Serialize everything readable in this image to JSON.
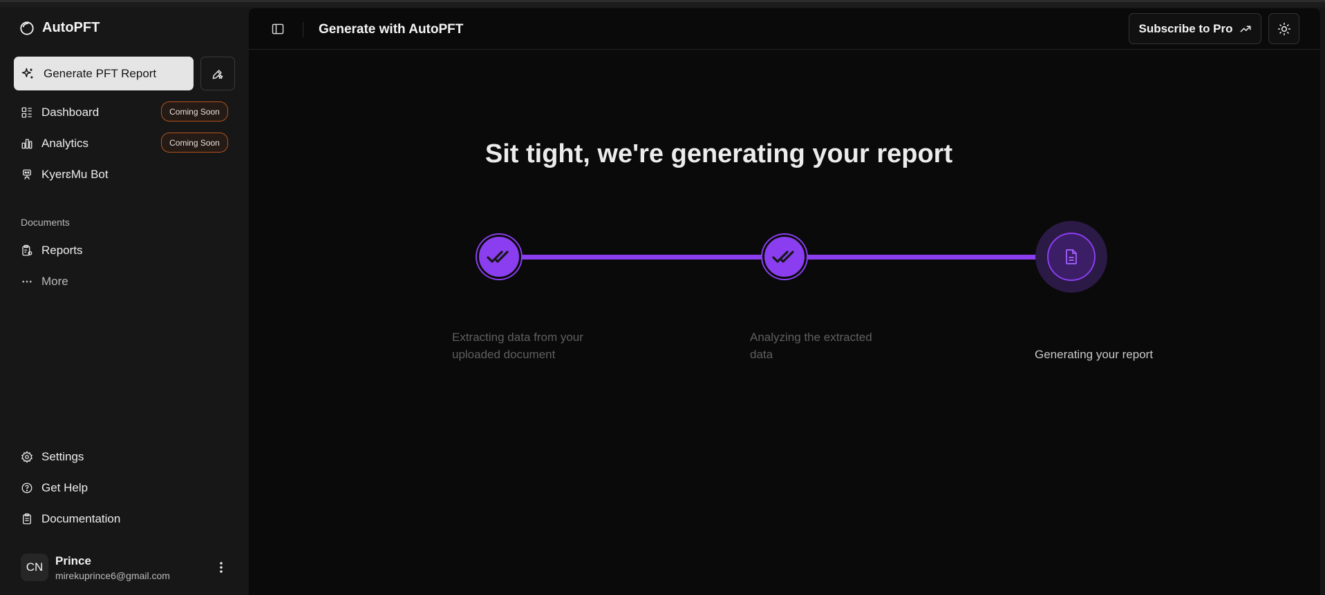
{
  "app": {
    "name": "AutoPFT"
  },
  "sidebar": {
    "generate_label": "Generate PFT Report",
    "nav": [
      {
        "label": "Dashboard",
        "badge": "Coming Soon"
      },
      {
        "label": "Analytics",
        "badge": "Coming Soon"
      },
      {
        "label": "KyerɛMu Bot"
      }
    ],
    "section_label": "Documents",
    "documents": [
      {
        "label": "Reports"
      },
      {
        "label": "More"
      }
    ],
    "footer_nav": [
      {
        "label": "Settings"
      },
      {
        "label": "Get Help"
      },
      {
        "label": "Documentation"
      }
    ],
    "user": {
      "initials": "CN",
      "name": "Prince",
      "email": "mirekuprince6@gmail.com"
    }
  },
  "header": {
    "title": "Generate with AutoPFT",
    "subscribe_label": "Subscribe to Pro"
  },
  "main": {
    "headline": "Sit tight, we're generating your report",
    "steps": [
      {
        "label": "Extracting data from your uploaded document",
        "status": "complete"
      },
      {
        "label": "Analyzing the extracted data",
        "status": "complete"
      },
      {
        "label": "Generating your report",
        "status": "in-progress"
      }
    ]
  },
  "colors": {
    "accent": "#8b3ef0",
    "sidebar_bg": "#171717",
    "main_bg": "#0a0a0a",
    "badge_border": "#b4541f"
  }
}
